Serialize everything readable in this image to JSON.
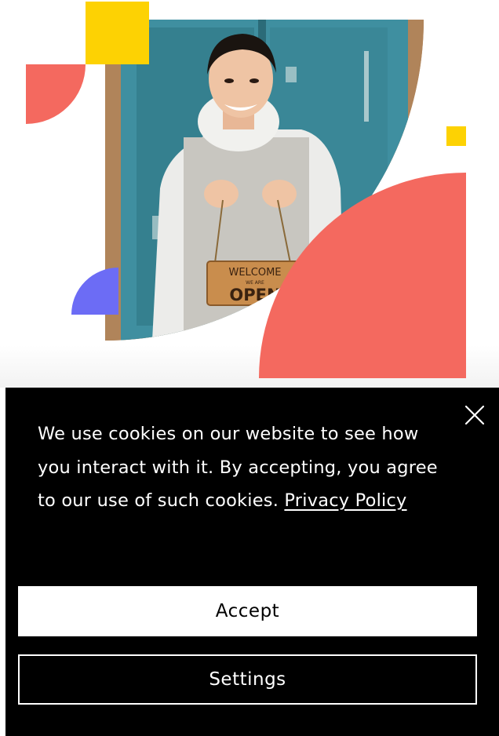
{
  "hero": {
    "photo_icon": "woman-holding-sign-photo",
    "sign_line1": "WELCOME",
    "sign_line2": "WE ARE",
    "sign_line3": "OPEN"
  },
  "colors": {
    "coral": "#f4695f",
    "yellow": "#fdd203",
    "purple": "#6c6cf5",
    "door_teal": "#3f8fa0",
    "banner_bg": "#000000"
  },
  "cookie_banner": {
    "close_icon": "close-icon",
    "message": "We use cookies on our website to see how you interact with it. By accepting, you agree to our use of such cookies.",
    "privacy_link": "Privacy Policy",
    "accept_label": "Accept",
    "settings_label": "Settings"
  }
}
